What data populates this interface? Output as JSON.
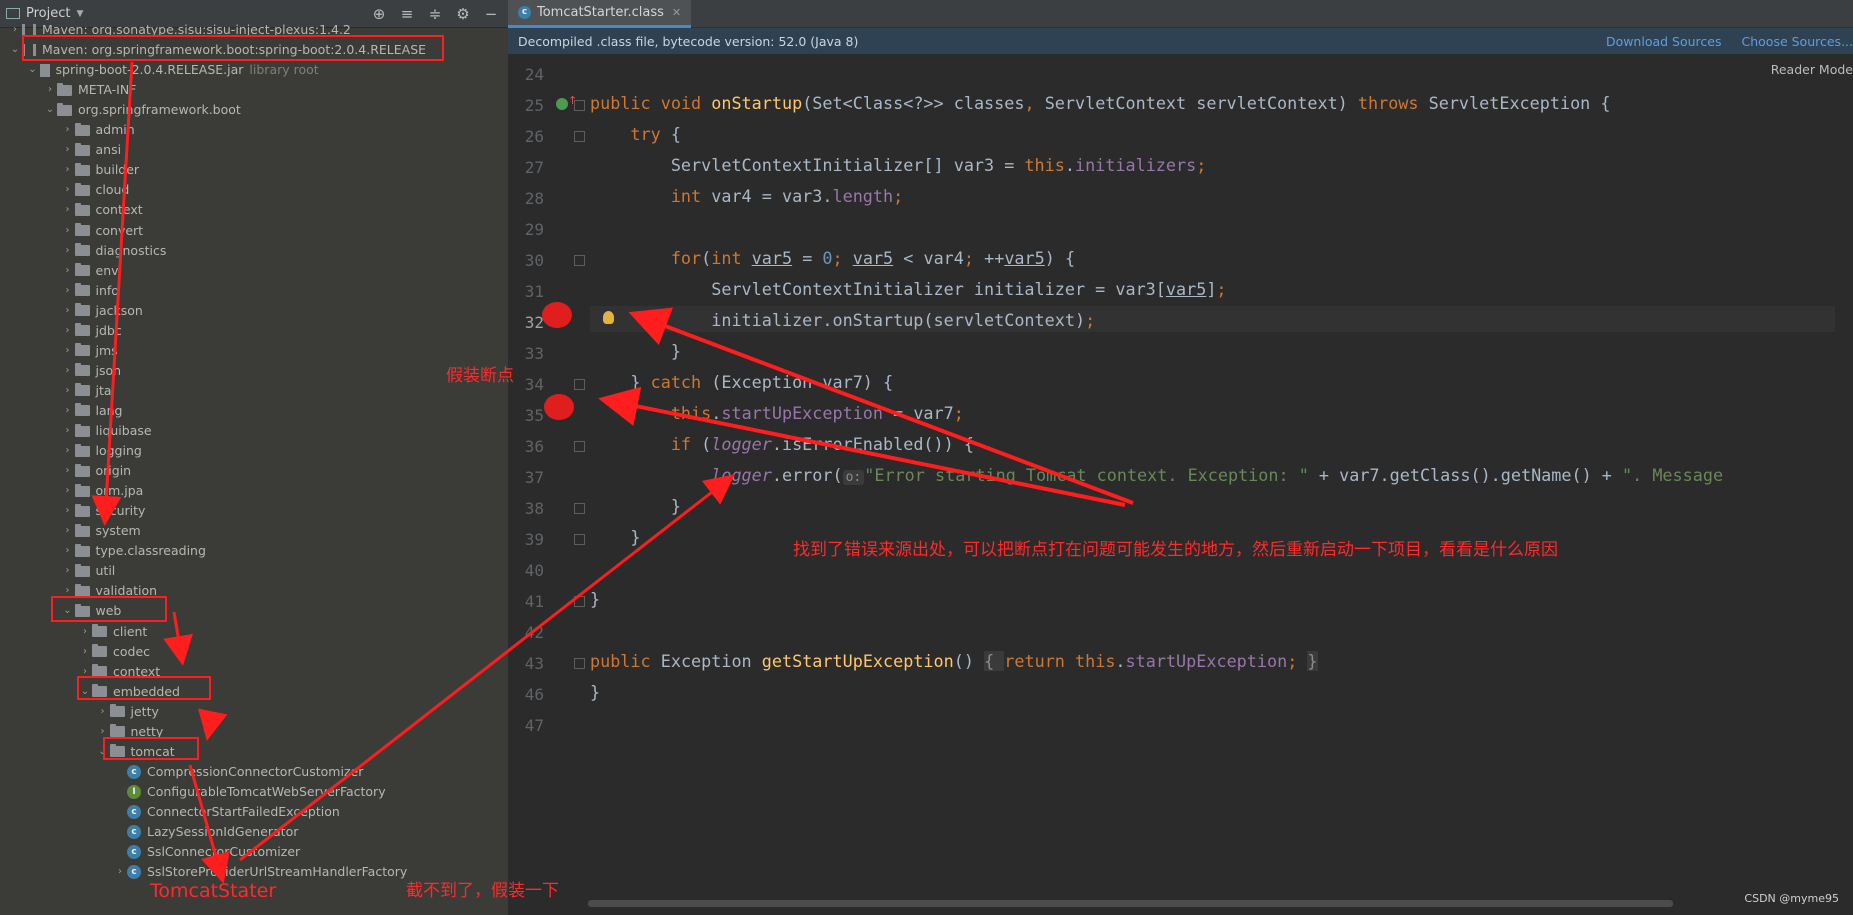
{
  "project": {
    "header_title": "Project",
    "rows": [
      {
        "depth": 1,
        "arrow": "›",
        "icon": "lib",
        "label": "Maven: org.sonatype.sisu:sisu-inject-plexus:1.4.2"
      },
      {
        "depth": 1,
        "arrow": "⌄",
        "icon": "lib",
        "label": "Maven: org.springframework.boot:spring-boot:2.0.4.RELEASE",
        "boxed": true
      },
      {
        "depth": 2,
        "arrow": "⌄",
        "icon": "jar",
        "label": "spring-boot-2.0.4.RELEASE.jar",
        "note": "library root"
      },
      {
        "depth": 3,
        "arrow": "›",
        "icon": "folder",
        "label": "META-INF"
      },
      {
        "depth": 3,
        "arrow": "⌄",
        "icon": "folder",
        "label": "org.springframework.boot"
      },
      {
        "depth": 4,
        "arrow": "›",
        "icon": "folder",
        "label": "admin"
      },
      {
        "depth": 4,
        "arrow": "›",
        "icon": "folder",
        "label": "ansi"
      },
      {
        "depth": 4,
        "arrow": "›",
        "icon": "folder",
        "label": "builder"
      },
      {
        "depth": 4,
        "arrow": "›",
        "icon": "folder",
        "label": "cloud"
      },
      {
        "depth": 4,
        "arrow": "›",
        "icon": "folder",
        "label": "context"
      },
      {
        "depth": 4,
        "arrow": "›",
        "icon": "folder",
        "label": "convert"
      },
      {
        "depth": 4,
        "arrow": "›",
        "icon": "folder",
        "label": "diagnostics"
      },
      {
        "depth": 4,
        "arrow": "›",
        "icon": "folder",
        "label": "env"
      },
      {
        "depth": 4,
        "arrow": "›",
        "icon": "folder",
        "label": "info"
      },
      {
        "depth": 4,
        "arrow": "›",
        "icon": "folder",
        "label": "jackson"
      },
      {
        "depth": 4,
        "arrow": "›",
        "icon": "folder",
        "label": "jdbc"
      },
      {
        "depth": 4,
        "arrow": "›",
        "icon": "folder",
        "label": "jms"
      },
      {
        "depth": 4,
        "arrow": "›",
        "icon": "folder",
        "label": "json"
      },
      {
        "depth": 4,
        "arrow": "›",
        "icon": "folder",
        "label": "jta"
      },
      {
        "depth": 4,
        "arrow": "›",
        "icon": "folder",
        "label": "lang"
      },
      {
        "depth": 4,
        "arrow": "›",
        "icon": "folder",
        "label": "liquibase"
      },
      {
        "depth": 4,
        "arrow": "›",
        "icon": "folder",
        "label": "logging"
      },
      {
        "depth": 4,
        "arrow": "›",
        "icon": "folder",
        "label": "origin"
      },
      {
        "depth": 4,
        "arrow": "›",
        "icon": "folder",
        "label": "orm.jpa"
      },
      {
        "depth": 4,
        "arrow": "›",
        "icon": "folder",
        "label": "security"
      },
      {
        "depth": 4,
        "arrow": "›",
        "icon": "folder",
        "label": "system"
      },
      {
        "depth": 4,
        "arrow": "›",
        "icon": "folder",
        "label": "type.classreading"
      },
      {
        "depth": 4,
        "arrow": "›",
        "icon": "folder",
        "label": "util"
      },
      {
        "depth": 4,
        "arrow": "›",
        "icon": "folder",
        "label": "validation"
      },
      {
        "depth": 4,
        "arrow": "⌄",
        "icon": "folder",
        "label": "web",
        "boxed": true
      },
      {
        "depth": 5,
        "arrow": "›",
        "icon": "folder",
        "label": "client"
      },
      {
        "depth": 5,
        "arrow": "›",
        "icon": "folder",
        "label": "codec"
      },
      {
        "depth": 5,
        "arrow": "›",
        "icon": "folder",
        "label": "context"
      },
      {
        "depth": 5,
        "arrow": "⌄",
        "icon": "folder",
        "label": "embedded",
        "boxed": true
      },
      {
        "depth": 6,
        "arrow": "›",
        "icon": "folder",
        "label": "jetty"
      },
      {
        "depth": 6,
        "arrow": "›",
        "icon": "folder",
        "label": "netty"
      },
      {
        "depth": 6,
        "arrow": "⌄",
        "icon": "folder",
        "label": "tomcat",
        "boxed": true
      },
      {
        "depth": 7,
        "arrow": "",
        "icon": "class",
        "label": "CompressionConnectorCustomizer"
      },
      {
        "depth": 7,
        "arrow": "",
        "icon": "iface",
        "label": "ConfigurableTomcatWebServerFactory"
      },
      {
        "depth": 7,
        "arrow": "",
        "icon": "class",
        "label": "ConnectorStartFailedException"
      },
      {
        "depth": 7,
        "arrow": "",
        "icon": "class",
        "label": "LazySessionIdGenerator"
      },
      {
        "depth": 7,
        "arrow": "",
        "icon": "class",
        "label": "SslConnectorCustomizer"
      },
      {
        "depth": 7,
        "arrow": "›",
        "icon": "class",
        "label": "SslStoreProviderUrlStreamHandlerFactory"
      }
    ]
  },
  "editor": {
    "tab_label": "TomcatStarter.class",
    "banner_text": "Decompiled .class file, bytecode version: 52.0 (Java 8)",
    "download_sources": "Download Sources",
    "choose_sources": "Choose Sources...",
    "reader_mode": "Reader Mode",
    "line_numbers": [
      "24",
      "25",
      "26",
      "27",
      "28",
      "29",
      "30",
      "31",
      "32",
      "33",
      "34",
      "35",
      "36",
      "37",
      "38",
      "39",
      "40",
      "41",
      "42",
      "43",
      "46",
      "47"
    ]
  },
  "annotations": {
    "fake_breakpoint": "假装断点",
    "found_error": "找到了错误来源出处，可以把断点打在问题可能发生的地方，然后重新启动一下项目，看看是什么原因",
    "tomcat_stater": "TomcatStater",
    "cannot_capture": "截不到了，假装一下"
  },
  "watermark": "CSDN @myme95"
}
